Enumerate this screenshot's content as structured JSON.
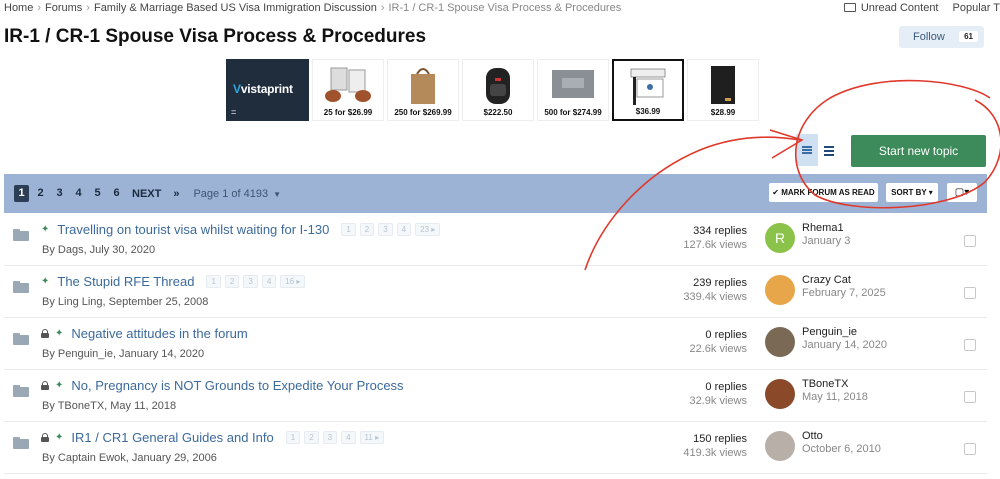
{
  "breadcrumb": {
    "home": "Home",
    "forums": "Forums",
    "section": "Family & Marriage Based US Visa Immigration Discussion",
    "current": "IR-1 / CR-1 Spouse Visa Process & Procedures"
  },
  "topnav": {
    "unread": "Unread Content",
    "popular": "Popular T"
  },
  "page_title": "IR-1 / CR-1 Spouse Visa Process & Procedures",
  "follow": {
    "label": "Follow",
    "count": "61"
  },
  "ads": [
    {
      "label": "vistaprint",
      "sub": "="
    },
    {
      "price": "25 for $26.99"
    },
    {
      "price": "250 for $269.99"
    },
    {
      "price": "$222.50"
    },
    {
      "price": "500 for $274.99"
    },
    {
      "price": "$36.99",
      "selected": true
    },
    {
      "price": "$28.99"
    }
  ],
  "new_topic": "Start new topic",
  "pagination": {
    "pages": [
      "1",
      "2",
      "3",
      "4",
      "5",
      "6"
    ],
    "next": "NEXT",
    "last": "»",
    "jump": "Page 1 of 4193"
  },
  "toolbar": {
    "mark_read": "✔ MARK FORUM AS READ",
    "sort_by": "SORT BY ▾",
    "select": "▢▾"
  },
  "topics": [
    {
      "title": "Travelling on tourist visa whilst waiting for I-130",
      "locked": false,
      "pinned": true,
      "pages": [
        "1",
        "2",
        "3",
        "4",
        "23 ▸"
      ],
      "by": "By Dags, July 30, 2020",
      "replies": "334 replies",
      "views": "127.6k views",
      "last_user": "Rhema1",
      "last_date": "January 3",
      "avatar_letter": "R",
      "avatar_color": "#8bc34a"
    },
    {
      "title": "The Stupid RFE Thread",
      "locked": false,
      "pinned": true,
      "pages": [
        "1",
        "2",
        "3",
        "4",
        "16 ▸"
      ],
      "by": "By Ling Ling, September 25, 2008",
      "replies": "239 replies",
      "views": "339.4k views",
      "last_user": "Crazy Cat",
      "last_date": "February 7, 2025",
      "avatar_letter": "",
      "avatar_color": "#e8a64a"
    },
    {
      "title": "Negative attitudes in the forum",
      "locked": true,
      "pinned": true,
      "pages": [],
      "by": "By Penguin_ie, January 14, 2020",
      "replies": "0 replies",
      "views": "22.6k views",
      "last_user": "Penguin_ie",
      "last_date": "January 14, 2020",
      "avatar_letter": "",
      "avatar_color": "#7a6a55"
    },
    {
      "title": "No, Pregnancy is NOT Grounds to Expedite Your Process",
      "locked": true,
      "pinned": true,
      "pages": [],
      "by": "By TBoneTX, May 11, 2018",
      "replies": "0 replies",
      "views": "32.9k views",
      "last_user": "TBoneTX",
      "last_date": "May 11, 2018",
      "avatar_letter": "",
      "avatar_color": "#8a4a2a"
    },
    {
      "title": "IR1 / CR1 General Guides and Info",
      "locked": true,
      "pinned": true,
      "pages": [
        "1",
        "2",
        "3",
        "4",
        "11 ▸"
      ],
      "by": "By Captain Ewok, January 29, 2006",
      "replies": "150 replies",
      "views": "419.3k views",
      "last_user": "Otto",
      "last_date": "October 6, 2010",
      "avatar_letter": "",
      "avatar_color": "#b8b0a8"
    }
  ],
  "colors": {
    "accent": "#3d8a5a",
    "bar": "#9cb3d6",
    "link": "#3c6a9c",
    "annotation": "#e0392b"
  }
}
